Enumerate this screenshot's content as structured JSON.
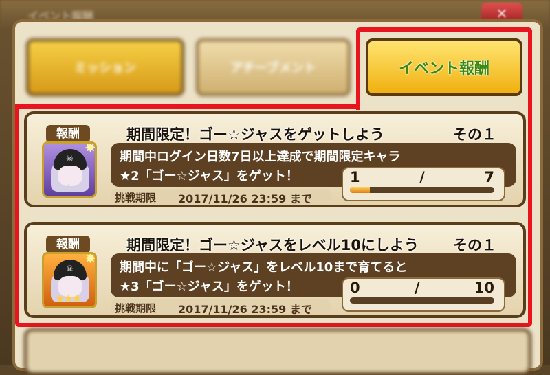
{
  "window": {
    "title": "イベント報酬",
    "close_label": "×"
  },
  "tabs": [
    {
      "label": "ミッション",
      "active": false
    },
    {
      "label": "アチーブメント",
      "active": false
    },
    {
      "label": "イベント報酬",
      "active": true
    }
  ],
  "highlight_color": "#e8141e",
  "missions": [
    {
      "badge": "報酬",
      "title": "期間限定！ゴー☆ジャスをゲットしよう",
      "number": "その１",
      "desc_line1": "期間中ログイン日数7日以上達成で期間限定キャラ",
      "desc_line2": "★2「ゴー☆ジャス」をゲット！",
      "progress_current": "1",
      "progress_sep": "/",
      "progress_total": "7",
      "progress_fraction": 0.14,
      "deadline_label": "挑戦期限",
      "deadline_value": "2017/11/26 23:59 まで",
      "stars": "★★",
      "avatar_color": "purple"
    },
    {
      "badge": "報酬",
      "title": "期間限定！ゴー☆ジャスをレベル10にしよう",
      "number": "その１",
      "desc_line1": "期間中に「ゴー☆ジャス」をレベル10まで育てると",
      "desc_line2": "★3「ゴー☆ジャス」をゲット！",
      "progress_current": "0",
      "progress_sep": "/",
      "progress_total": "10",
      "progress_fraction": 0,
      "deadline_label": "挑戦期限",
      "deadline_value": "2017/11/26 23:59 まで",
      "stars": "★★★",
      "avatar_color": "orange"
    }
  ]
}
